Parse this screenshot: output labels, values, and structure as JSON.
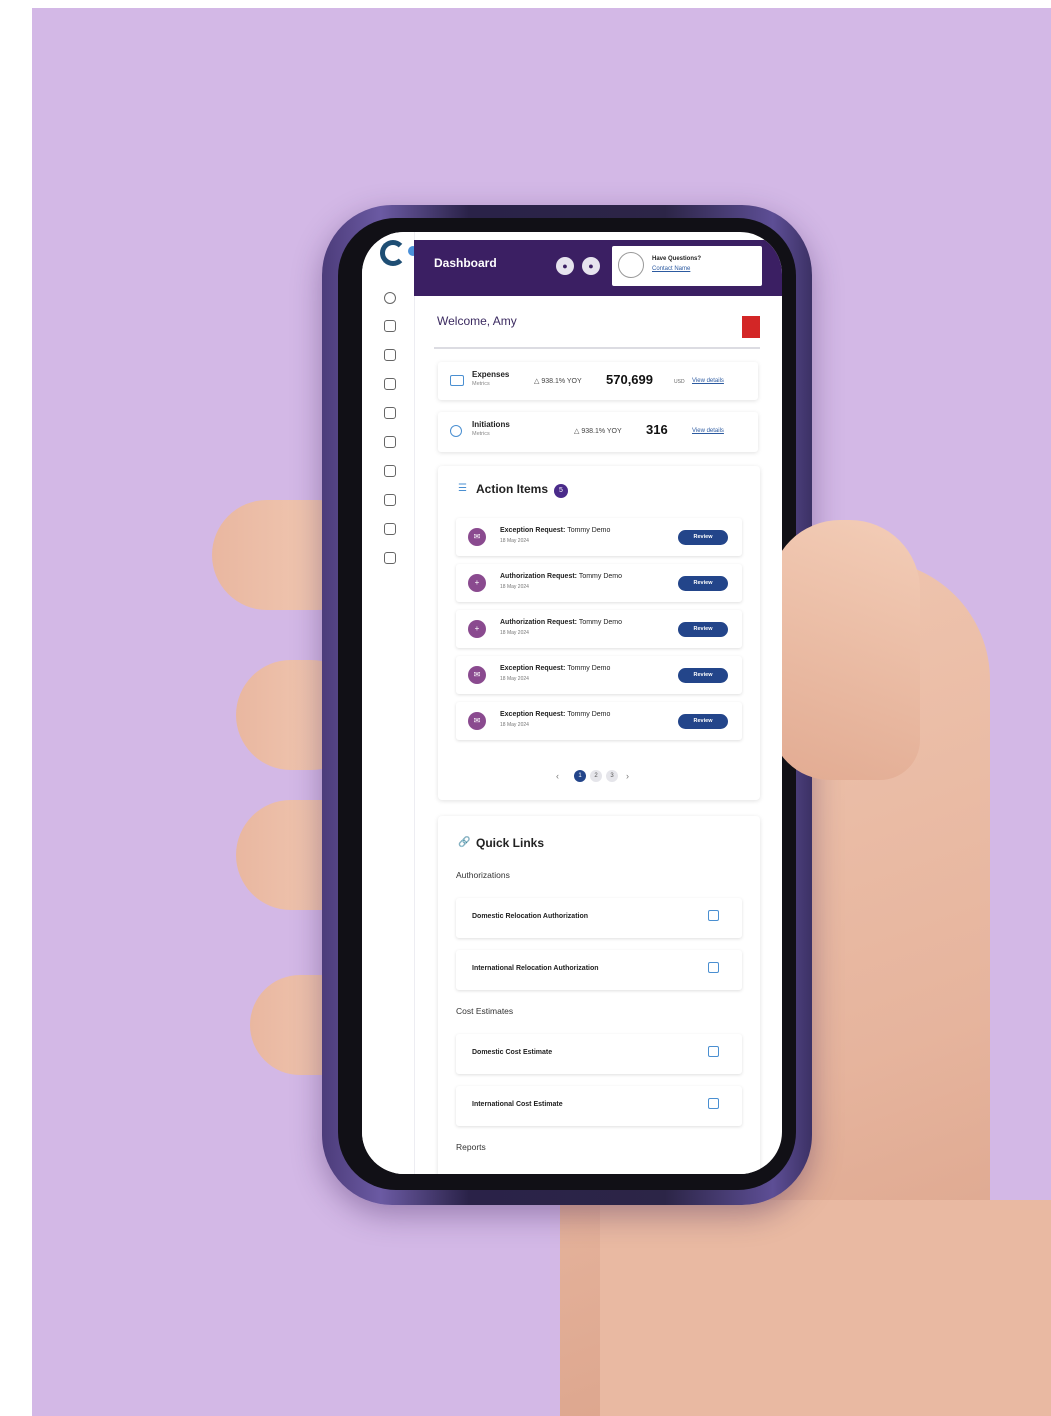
{
  "header": {
    "title": "Dashboard",
    "help_question": "Have Questions?",
    "help_link": "Contact Name"
  },
  "welcome": "Welcome, Amy",
  "metrics": [
    {
      "name": "Expenses",
      "sub": "Metrics",
      "yoy": "△ 938.1% YOY",
      "value": "570,699",
      "unit": "USD",
      "link": "View details"
    },
    {
      "name": "Initiations",
      "sub": "Metrics",
      "yoy": "△ 938.1% YOY",
      "value": "316",
      "unit": "",
      "link": "View details"
    }
  ],
  "action_items": {
    "title": "Action Items",
    "count": "5",
    "items": [
      {
        "type": "Exception Request:",
        "person": "Tommy Demo",
        "date": "18 May 2024",
        "button": "Review"
      },
      {
        "type": "Authorization Request:",
        "person": "Tommy Demo",
        "date": "18 May 2024",
        "button": "Review"
      },
      {
        "type": "Authorization Request:",
        "person": "Tommy Demo",
        "date": "18 May 2024",
        "button": "Review"
      },
      {
        "type": "Exception Request:",
        "person": "Tommy Demo",
        "date": "18 May 2024",
        "button": "Review"
      },
      {
        "type": "Exception Request:",
        "person": "Tommy Demo",
        "date": "18 May 2024",
        "button": "Review"
      }
    ],
    "pages": [
      "1",
      "2",
      "3"
    ],
    "prev": "‹",
    "next": "›"
  },
  "quick_links": {
    "title": "Quick Links",
    "groups": [
      {
        "name": "Authorizations",
        "links": [
          "Domestic Relocation Authorization",
          "International Relocation Authorization"
        ]
      },
      {
        "name": "Cost Estimates",
        "links": [
          "Domestic Cost Estimate",
          "International Cost Estimate"
        ]
      },
      {
        "name": "Reports",
        "links": []
      }
    ]
  },
  "colors": {
    "header": "#3b1f63",
    "accent": "#23458a",
    "badge": "#4a2b8a",
    "background": "#d3b8e6"
  },
  "icons": {
    "rail": [
      "info-icon",
      "network-icon",
      "billing-icon",
      "add-user-icon",
      "monitor-icon",
      "document-icon",
      "contact-card-icon",
      "chart-icon",
      "book-icon",
      "file-icon"
    ],
    "header": [
      "bell-icon",
      "user-icon"
    ]
  }
}
